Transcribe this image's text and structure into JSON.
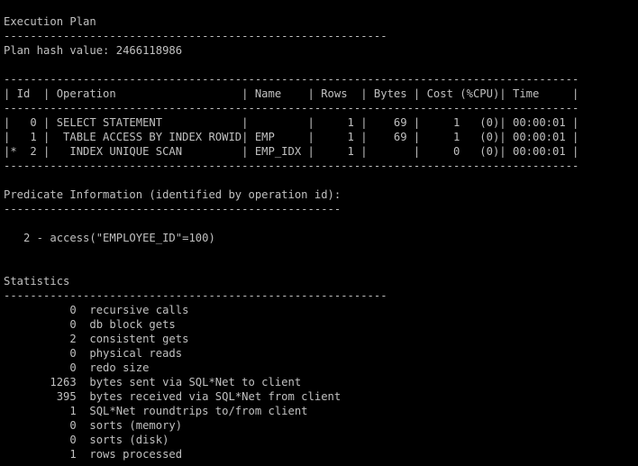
{
  "terminal": {
    "lines": [
      "Execution Plan",
      "----------------------------------------------------------",
      "Plan hash value: 2466118986",
      "",
      "---------------------------------------------------------------------------------------",
      "| Id  | Operation                   | Name    | Rows  | Bytes | Cost (%CPU)| Time     |",
      "---------------------------------------------------------------------------------------",
      "|   0 | SELECT STATEMENT            |         |     1 |    69 |     1   (0)| 00:00:01 |",
      "|   1 |  TABLE ACCESS BY INDEX ROWID| EMP     |     1 |    69 |     1   (0)| 00:00:01 |",
      "|*  2 |   INDEX UNIQUE SCAN         | EMP_IDX |     1 |       |     0   (0)| 00:00:01 |",
      "---------------------------------------------------------------------------------------",
      "",
      "Predicate Information (identified by operation id):",
      "---------------------------------------------------",
      "",
      "   2 - access(\"EMPLOYEE_ID\"=100)",
      "",
      "",
      "Statistics",
      "----------------------------------------------------------",
      "          0  recursive calls",
      "          0  db block gets",
      "          2  consistent gets",
      "          0  physical reads",
      "          0  redo size",
      "       1263  bytes sent via SQL*Net to client",
      "        395  bytes received via SQL*Net from client",
      "          1  SQL*Net roundtrips to/from client",
      "          0  sorts (memory)",
      "          0  sorts (disk)",
      "          1  rows processed"
    ]
  }
}
